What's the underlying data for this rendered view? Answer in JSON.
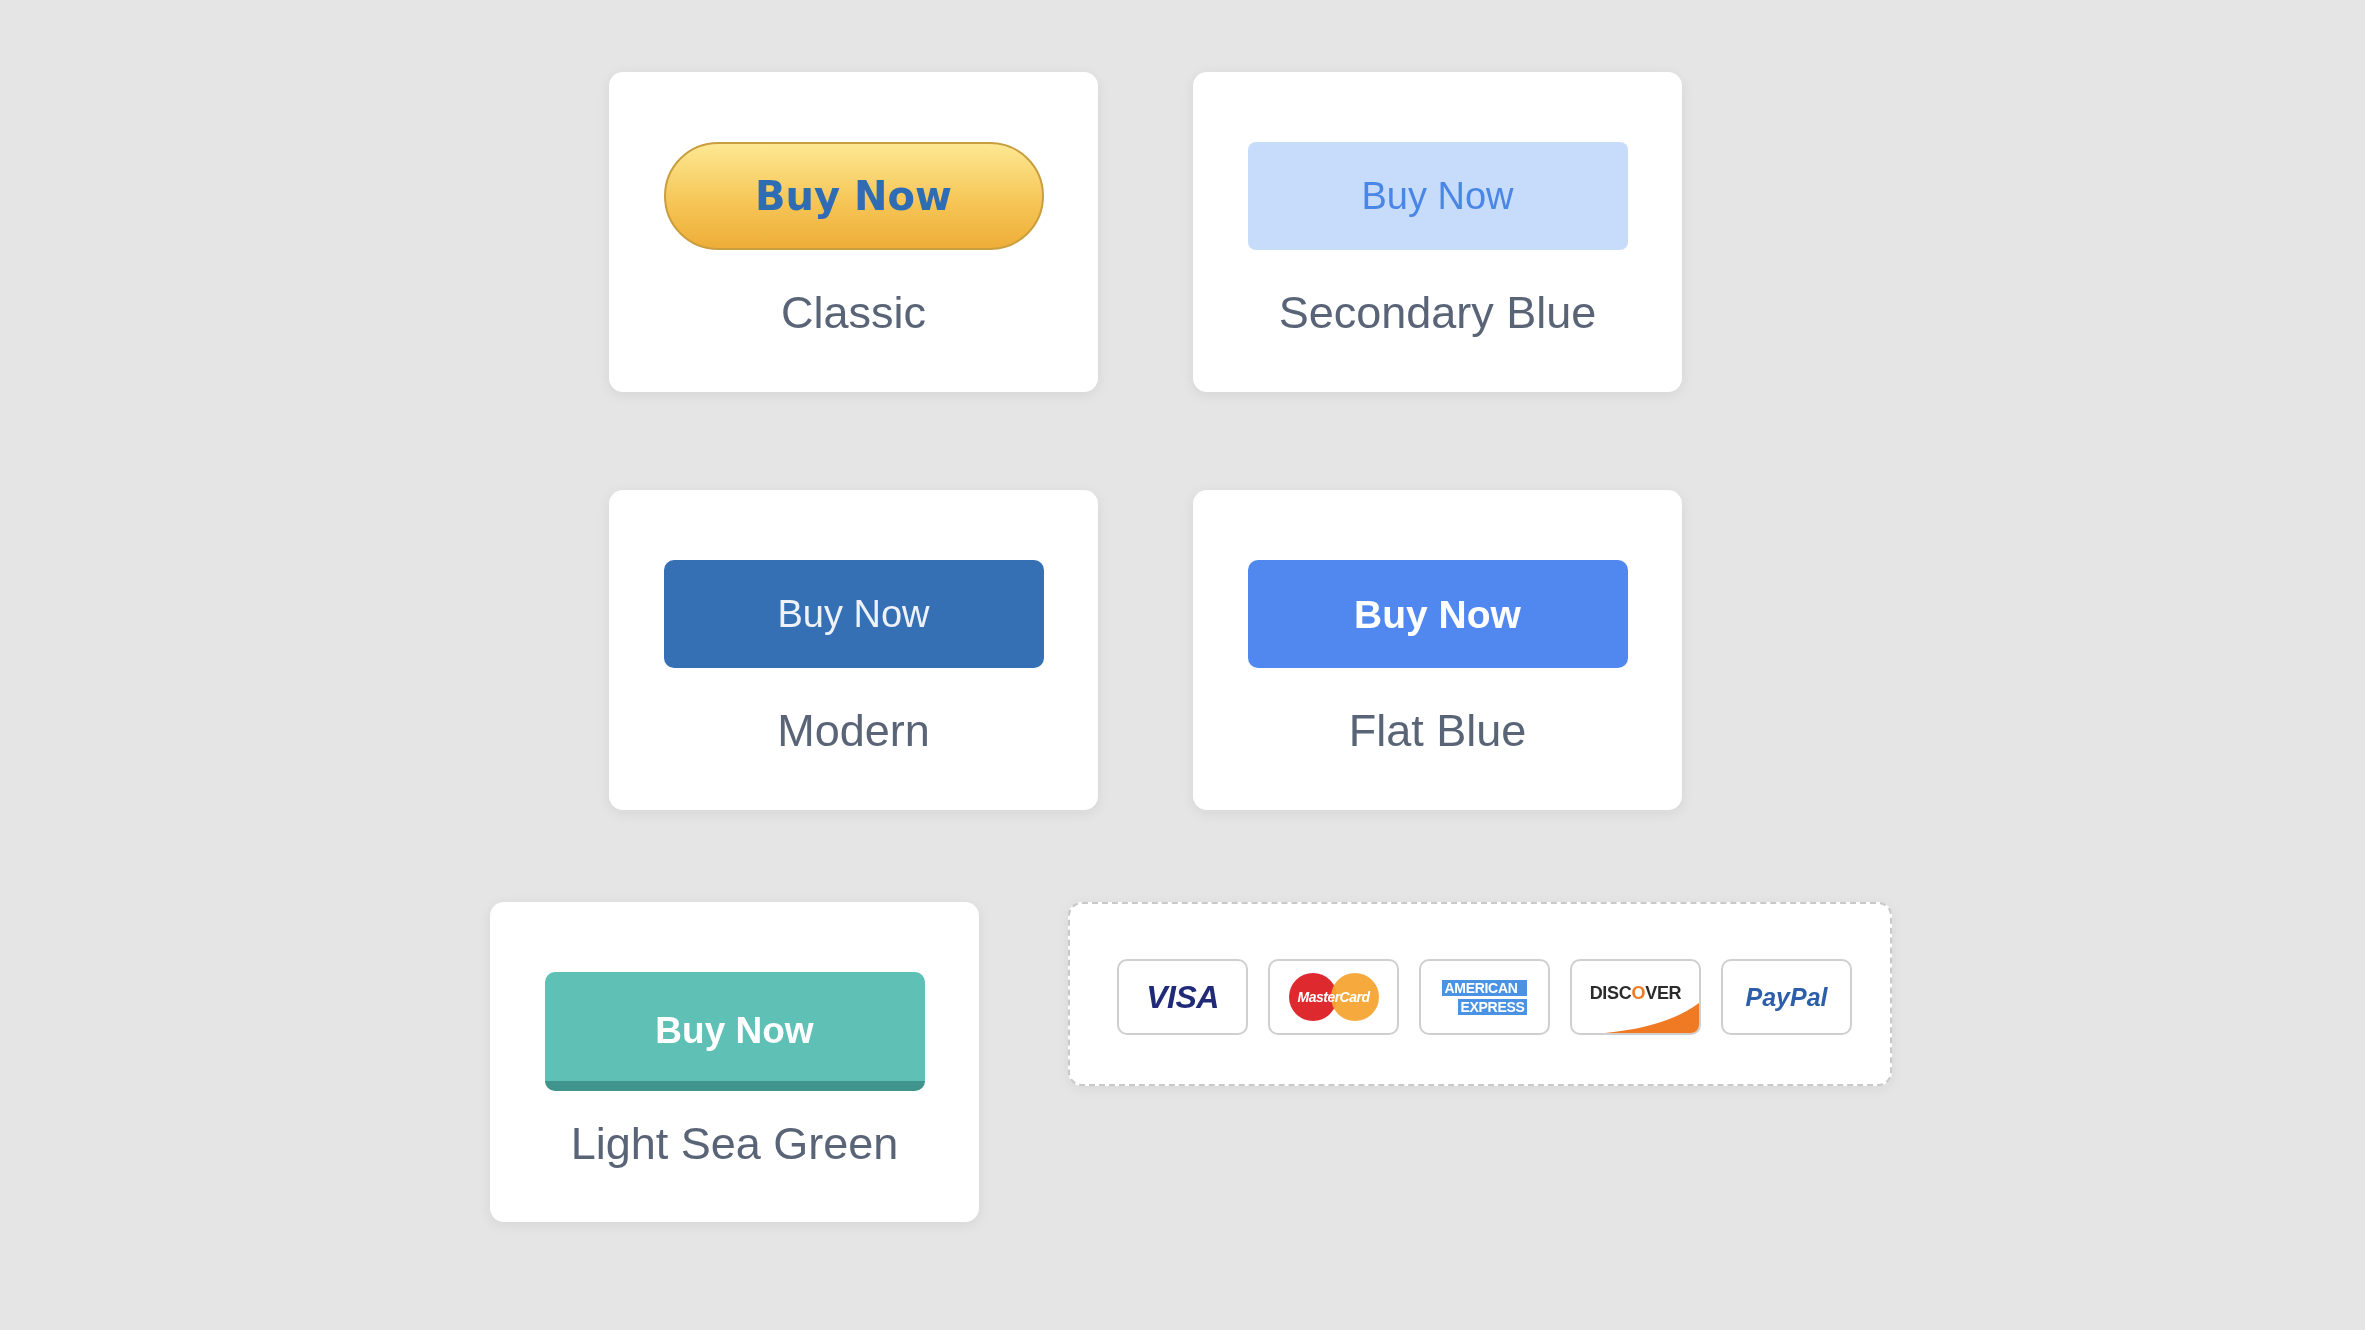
{
  "button_styles": [
    {
      "kind": "classic",
      "button": "Buy Now",
      "caption": "Classic"
    },
    {
      "kind": "secondary",
      "button": "Buy Now",
      "caption": "Secondary Blue"
    },
    {
      "kind": "modern",
      "button": "Buy Now",
      "caption": "Modern"
    },
    {
      "kind": "flat",
      "button": "Buy Now",
      "caption": "Flat Blue"
    },
    {
      "kind": "sea_green",
      "button": "Buy Now",
      "caption": "Light Sea Green"
    }
  ],
  "payment_methods": [
    {
      "kind": "visa",
      "lines": [
        "VISA"
      ]
    },
    {
      "kind": "mastercard",
      "lines": [
        "MasterCard"
      ]
    },
    {
      "kind": "amex",
      "lines": [
        "AMERICAN",
        "EXPRESS"
      ]
    },
    {
      "kind": "discover",
      "lines": [
        "DISCOVER"
      ]
    },
    {
      "kind": "paypal",
      "lines": [
        "PayPal"
      ]
    }
  ]
}
